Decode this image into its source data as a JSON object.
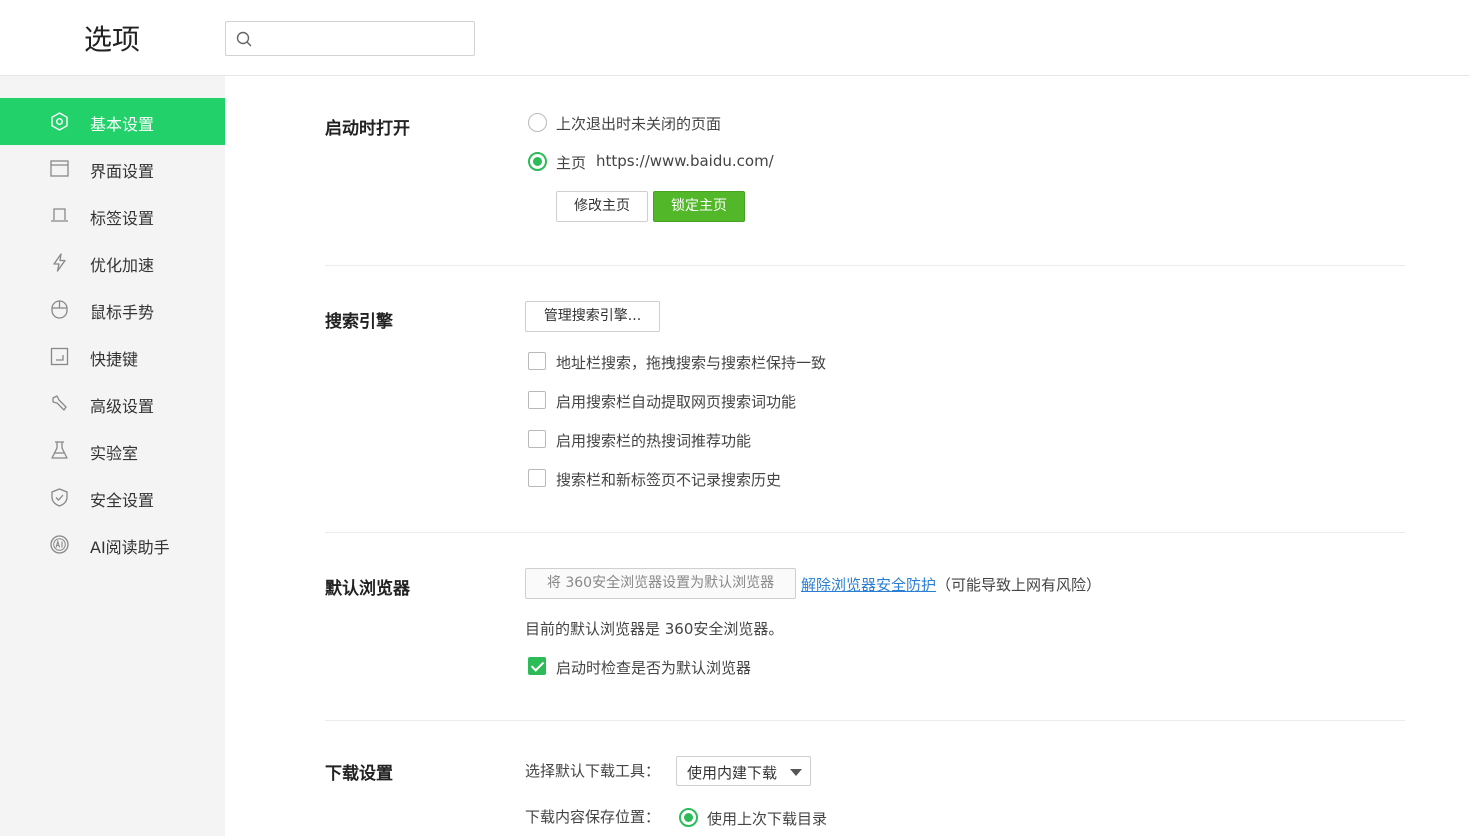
{
  "header": {
    "title": "选项",
    "search": {
      "value": "",
      "placeholder": ""
    }
  },
  "sidebar": {
    "items": [
      {
        "label": "基本设置",
        "icon": "basic-settings-icon",
        "active": true
      },
      {
        "label": "界面设置",
        "icon": "window-icon",
        "active": false
      },
      {
        "label": "标签设置",
        "icon": "tab-icon",
        "active": false
      },
      {
        "label": "优化加速",
        "icon": "lightning-icon",
        "active": false
      },
      {
        "label": "鼠标手势",
        "icon": "mouse-icon",
        "active": false
      },
      {
        "label": "快捷键",
        "icon": "shortcut-icon",
        "active": false
      },
      {
        "label": "高级设置",
        "icon": "wrench-icon",
        "active": false
      },
      {
        "label": "实验室",
        "icon": "flask-icon",
        "active": false
      },
      {
        "label": "安全设置",
        "icon": "shield-icon",
        "active": false
      },
      {
        "label": "AI阅读助手",
        "icon": "ai-icon",
        "active": false
      }
    ]
  },
  "startup": {
    "title": "启动时打开",
    "option_last": "上次退出时未关闭的页面",
    "option_home": "主页",
    "home_url": "https://www.baidu.com/",
    "selected": "home",
    "modify_button": "修改主页",
    "lock_button": "锁定主页"
  },
  "search_engine": {
    "title": "搜索引擎",
    "manage_button": "管理搜索引擎...",
    "options": [
      {
        "label": "地址栏搜索，拖拽搜索与搜索栏保持一致",
        "checked": false
      },
      {
        "label": "启用搜索栏自动提取网页搜索词功能",
        "checked": false
      },
      {
        "label": "启用搜索栏的热搜词推荐功能",
        "checked": false
      },
      {
        "label": "搜索栏和新标签页不记录搜索历史",
        "checked": false
      }
    ]
  },
  "default_browser": {
    "title": "默认浏览器",
    "set_default_button": "将 360安全浏览器设置为默认浏览器",
    "unlock_link": "解除浏览器安全防护",
    "risk_note": "（可能导致上网有风险）",
    "status_text": "目前的默认浏览器是 360安全浏览器。",
    "check_on_start": {
      "label": "启动时检查是否为默认浏览器",
      "checked": true
    }
  },
  "download": {
    "title": "下载设置",
    "tool_label": "选择默认下载工具：",
    "tool_selected": "使用内建下载",
    "location_label": "下载内容保存位置：",
    "location_option": "使用上次下载目录",
    "location_selected": true
  },
  "colors": {
    "accent": "#23d16b",
    "green_button": "#52b829",
    "link": "#2a7fd4"
  }
}
